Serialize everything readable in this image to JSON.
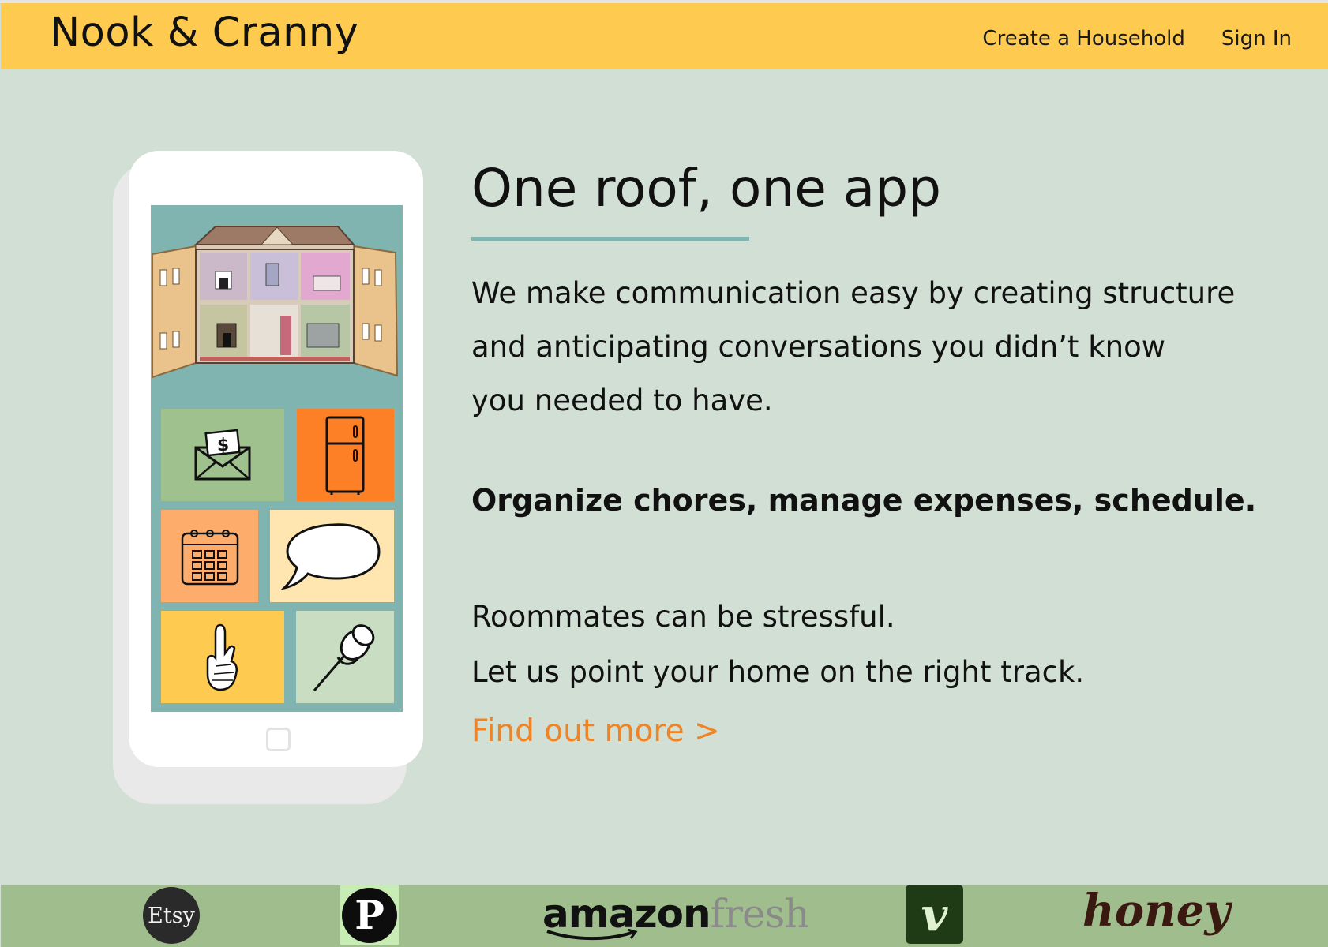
{
  "header": {
    "brand": "Nook & Cranny",
    "nav": {
      "create_household": "Create a Household",
      "sign_in": "Sign In"
    },
    "background_color": "#fecb50"
  },
  "hero": {
    "headline": "One roof, one app",
    "intro_lines": [
      "We make communication easy by creating structure",
      "and anticipating conversations you didn’t know",
      "you needed to have."
    ],
    "features": "Organize chores, manage expenses, schedule.",
    "stress_lines": [
      "Roommates can be stressful.",
      "Let us point your home on the right track."
    ],
    "cta": "Find out more >",
    "cta_color": "#f08323",
    "accent_color": "#7fb4b0"
  },
  "phone": {
    "tiles": [
      {
        "icon": "money-envelope-icon",
        "color": "#9fc18e"
      },
      {
        "icon": "fridge-icon",
        "color": "#fd8027"
      },
      {
        "icon": "calendar-icon",
        "color": "#feac6b"
      },
      {
        "icon": "speech-bubble-icon",
        "color": "#ffe5af"
      },
      {
        "icon": "crossed-fingers-icon",
        "color": "#fecb50"
      },
      {
        "icon": "pushpin-icon",
        "color": "#c8ddc2"
      }
    ]
  },
  "partners": {
    "etsy": "Etsy",
    "pinterest": "P",
    "amazon_a": "amazon",
    "amazon_b": "fresh",
    "venmo": "v",
    "honey": "honey"
  },
  "colors": {
    "page_background": "#d1dfd4",
    "footer_background": "#a0bd8d"
  }
}
